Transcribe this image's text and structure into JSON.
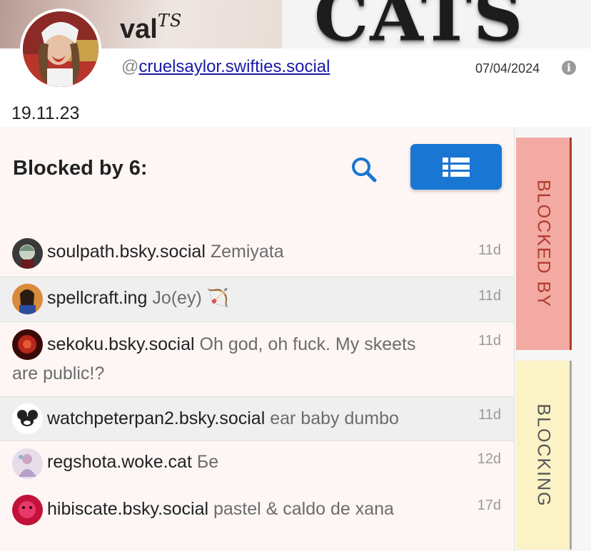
{
  "banner": {
    "text": "CATS"
  },
  "profile": {
    "display_name": "val",
    "display_name_suffix": "TS",
    "handle_prefix": "@",
    "handle": "cruelsaylor.swifties.social",
    "joined": "07/04/2024",
    "info_icon": "info-icon",
    "bio": "19.11.23"
  },
  "panel": {
    "title": "Blocked by 6:",
    "search_icon": "search-icon",
    "list_icon": "list-icon"
  },
  "rows": [
    {
      "handle": "soulpath.bsky.social",
      "name": "Zemiyata",
      "age": "11d"
    },
    {
      "handle": "spellcraft.ing",
      "name": "Jo(ey) 🏹",
      "age": "11d"
    },
    {
      "handle": "sekoku.bsky.social",
      "name": "Oh god, oh fuck. My skeets",
      "name_cont": "are public!?",
      "age": "11d"
    },
    {
      "handle": "watchpeterpan2.bsky.social",
      "name": "ear baby dumbo",
      "age": "11d"
    },
    {
      "handle": "regshota.woke.cat",
      "name": "Бе",
      "age": "12d"
    },
    {
      "handle": "hibiscate.bsky.social",
      "name": "pastel & caldo de xana",
      "age": "17d"
    }
  ],
  "tabs": {
    "blocked_by": "BLOCKED BY",
    "blocking": "BLOCKING"
  },
  "colors": {
    "accent": "#1976d2",
    "blocked_by_tab": "#f2aaa2",
    "blocking_tab": "#fbf2c6"
  }
}
